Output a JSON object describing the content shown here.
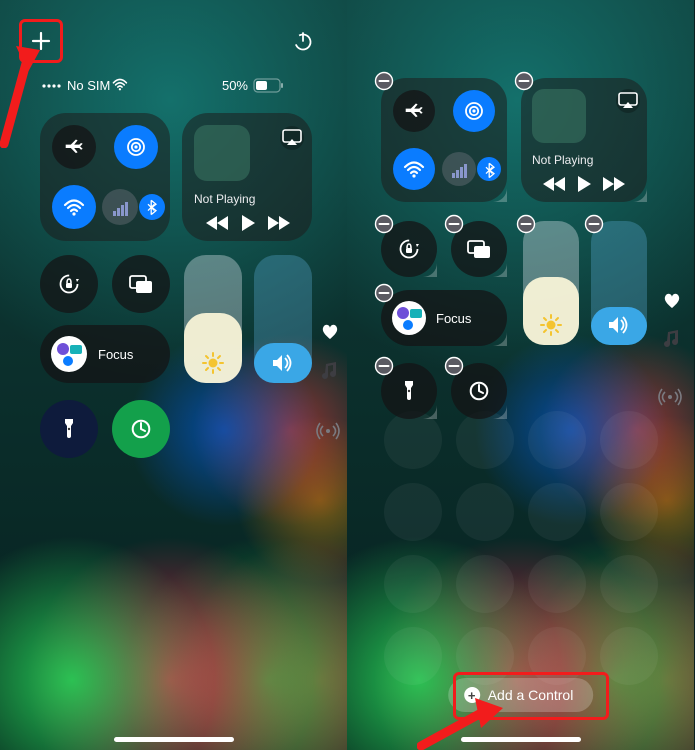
{
  "left": {
    "status": {
      "carrier": "No SIM",
      "battery_pct": "50%"
    },
    "media": {
      "title": "Not Playing"
    },
    "focus_label": "Focus"
  },
  "right": {
    "media": {
      "title": "Not Playing"
    },
    "focus_label": "Focus",
    "add_control_label": "Add a Control"
  },
  "icons": {
    "plus": "plus-icon",
    "power": "power-icon",
    "airplane": "airplane-icon",
    "airdrop": "airdrop-icon",
    "wifi": "wifi-icon",
    "cellular": "cellular-icon",
    "bluetooth": "bluetooth-icon",
    "airplay": "airplay-icon",
    "rewind": "rewind-icon",
    "play": "play-icon",
    "forward": "forward-icon",
    "lock_rotate": "rotation-lock-icon",
    "mirror": "screen-mirror-icon",
    "moon": "moon-icon",
    "brightness_sun": "brightness-icon",
    "volume": "volume-icon",
    "heart": "heart-icon",
    "music": "music-icon",
    "hotspot": "hotspot-icon",
    "torch": "flashlight-icon",
    "timer": "timer-icon",
    "minus": "remove-icon",
    "resize": "resize-handle-icon"
  },
  "colors": {
    "accent_blue": "#0a7cff",
    "highlight_red": "#f21c1c",
    "active_green": "#13a04b"
  }
}
